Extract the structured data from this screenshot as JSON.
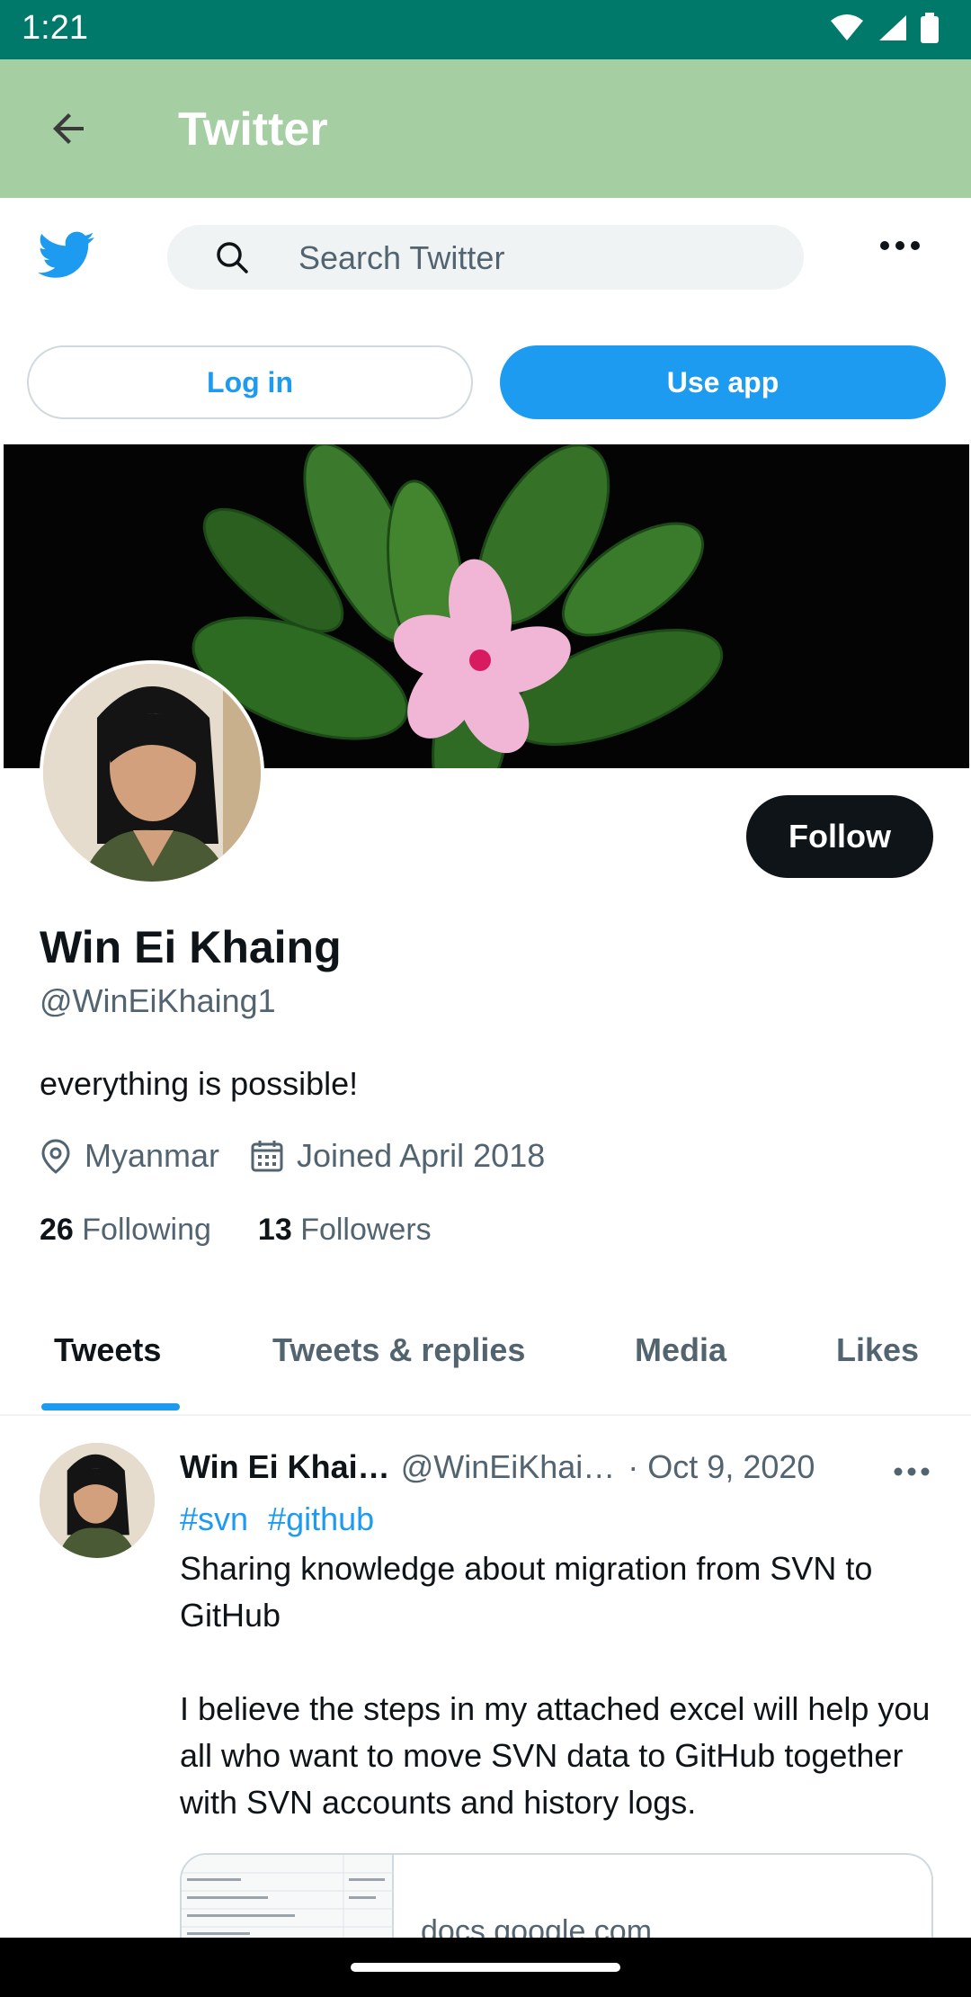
{
  "status_bar": {
    "time": "1:21"
  },
  "app_bar": {
    "title": "Twitter"
  },
  "search": {
    "placeholder": "Search Twitter"
  },
  "auth": {
    "login_label": "Log in",
    "use_app_label": "Use app"
  },
  "profile": {
    "follow_label": "Follow",
    "display_name": "Win Ei Khaing",
    "handle": "@WinEiKhaing1",
    "bio": "everything is possible!",
    "location": "Myanmar",
    "joined": "Joined April 2018",
    "following_count": "26",
    "following_label": "Following",
    "followers_count": "13",
    "followers_label": "Followers"
  },
  "tabs": [
    {
      "label": "Tweets"
    },
    {
      "label": "Tweets & replies"
    },
    {
      "label": "Media"
    },
    {
      "label": "Likes"
    }
  ],
  "tweet": {
    "name": "Win Ei Khai…",
    "handle": "@WinEiKhai…",
    "separator": "·",
    "date": "Oct 9, 2020",
    "hashtags": [
      "#svn",
      "#github"
    ],
    "paragraphs": [
      "Sharing knowledge about migration from SVN to GitHub",
      "I believe the steps in my attached excel will help you all who want to move SVN data to GitHub together with SVN accounts and history logs."
    ],
    "card_domain": "docs.google.com"
  },
  "colors": {
    "status_bar": "#00796b",
    "app_bar": "#a5cea3",
    "twitter_blue": "#1d9bf0",
    "text_primary": "#0f1419",
    "text_secondary": "#536471"
  },
  "icons": {
    "back": "arrow-left-icon",
    "logo": "twitter-bird-icon",
    "search": "search-icon",
    "more": "more-horizontal-icon",
    "location": "location-pin-icon",
    "calendar": "calendar-icon"
  }
}
